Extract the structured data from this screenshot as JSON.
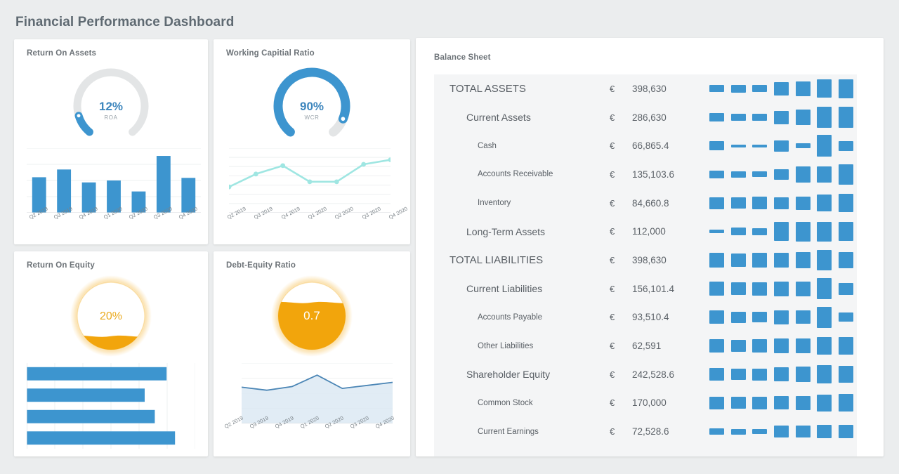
{
  "header": {
    "title": "Financial Performance Dashboard"
  },
  "colors": {
    "page_bg": "#ebedee",
    "card_bg": "#ffffff",
    "blue": "#3d95cf",
    "light_blue": "#9fe6e2",
    "orange": "#f2a50c",
    "text_grey": "#5f6a72"
  },
  "cards": [
    {
      "id": "roa",
      "title": "Return On Assets",
      "gauge": {
        "type": "arc",
        "value_label": "12%",
        "sub_label": "ROA",
        "percent": 12,
        "color": "#3d95cf",
        "track_color": "#e3e5e6"
      },
      "chart": {
        "type": "bar",
        "categories": [
          "Q2 2019",
          "Q3 2019",
          "Q4 2019",
          "Q1 2020",
          "Q2 2020",
          "Q3 2020",
          "Q4 2020"
        ],
        "values": [
          55,
          67,
          47,
          50,
          33,
          88,
          54
        ],
        "ylim": [
          0,
          100
        ],
        "color": "#3d95cf",
        "grid": true
      }
    },
    {
      "id": "wcr",
      "title": "Working Capitial Ratio",
      "gauge": {
        "type": "arc",
        "value_label": "90%",
        "sub_label": "WCR",
        "percent": 90,
        "color": "#3d95cf",
        "track_color": "#e3e5e6"
      },
      "chart": {
        "type": "line",
        "categories": [
          "Q2 2019",
          "Q3 2019",
          "Q4 2019",
          "Q1 2020",
          "Q2 2020",
          "Q3 2020",
          "Q4 2020"
        ],
        "values": [
          40,
          60,
          73,
          48,
          48,
          75,
          82
        ],
        "ylim": [
          0,
          100
        ],
        "color": "#9fe6e2",
        "grid": true
      }
    },
    {
      "id": "roe",
      "title": "Return On Equity",
      "gauge": {
        "type": "liquid-fill",
        "value_label": "20%",
        "sub_label": "",
        "percent": 20,
        "color": "#f2a50c",
        "track_color": "#ffffff"
      },
      "chart": {
        "type": "bar-horizontal",
        "categories": [
          "",
          "",
          "",
          ""
        ],
        "values": [
          83,
          70,
          76,
          88
        ],
        "ylim": [
          0,
          100
        ],
        "color": "#3d95cf",
        "grid": true
      }
    },
    {
      "id": "der",
      "title": "Debt-Equity Ratio",
      "gauge": {
        "type": "liquid-fill",
        "value_label": "0.7",
        "sub_label": "",
        "percent": 70,
        "color": "#f2a50c",
        "track_color": "#ffffff"
      },
      "chart": {
        "type": "area",
        "categories": [
          "Q2 2019",
          "Q3 2019",
          "Q4 2019",
          "Q1 2020",
          "Q2 2020",
          "Q3 2020",
          "Q4 2020"
        ],
        "values": [
          60,
          55,
          61,
          80,
          58,
          63,
          68
        ],
        "ylim": [
          0,
          100
        ],
        "color": "#4a85b5",
        "fill_color": "#dce9f3",
        "grid": true
      }
    }
  ],
  "balance_sheet": {
    "title": "Balance Sheet",
    "currency": "€",
    "rows": [
      {
        "label": "TOTAL ASSETS",
        "level": 0,
        "currency": "€",
        "amount": "398,630",
        "spark": [
          30,
          32,
          30,
          54,
          60,
          76,
          80
        ]
      },
      {
        "label": "Current Assets",
        "level": 1,
        "currency": "€",
        "amount": "286,630",
        "spark": [
          36,
          30,
          32,
          56,
          62,
          86,
          88
        ]
      },
      {
        "label": "Cash",
        "level": 2,
        "currency": "€",
        "amount": "66,865.4",
        "spark": [
          38,
          12,
          12,
          46,
          20,
          92,
          42
        ]
      },
      {
        "label": "Accounts Receivable",
        "level": 2,
        "currency": "€",
        "amount": "135,103.6",
        "spark": [
          30,
          26,
          24,
          46,
          68,
          70,
          86
        ]
      },
      {
        "label": "Inventory",
        "level": 2,
        "currency": "€",
        "amount": "84,660.8",
        "spark": [
          50,
          46,
          52,
          50,
          56,
          72,
          78
        ]
      },
      {
        "label": "Long-Term Assets",
        "level": 1,
        "currency": "€",
        "amount": "112,000",
        "spark": [
          14,
          32,
          30,
          80,
          84,
          82,
          80
        ]
      },
      {
        "label": "TOTAL LIABILITIES",
        "level": 0,
        "currency": "€",
        "amount": "398,630",
        "spark": [
          60,
          58,
          62,
          64,
          68,
          84,
          70
        ]
      },
      {
        "label": "Current Liabilities",
        "level": 1,
        "currency": "€",
        "amount": "156,101.4",
        "spark": [
          58,
          54,
          56,
          62,
          62,
          88,
          50
        ]
      },
      {
        "label": "Accounts Payable",
        "level": 2,
        "currency": "€",
        "amount": "93,510.4",
        "spark": [
          56,
          48,
          44,
          58,
          56,
          90,
          38
        ]
      },
      {
        "label": "Other Liabilities",
        "level": 2,
        "currency": "€",
        "amount": "62,591",
        "spark": [
          56,
          50,
          54,
          62,
          64,
          74,
          72
        ]
      },
      {
        "label": "Shareholder Equity",
        "level": 1,
        "currency": "€",
        "amount": "242,528.6",
        "spark": [
          52,
          48,
          50,
          58,
          66,
          78,
          72
        ]
      },
      {
        "label": "Common Stock",
        "level": 2,
        "currency": "€",
        "amount": "170,000",
        "spark": [
          54,
          50,
          52,
          56,
          60,
          70,
          74
        ]
      },
      {
        "label": "Current Earnings",
        "level": 2,
        "currency": "€",
        "amount": "72,528.6",
        "spark": [
          28,
          24,
          22,
          48,
          52,
          56,
          54
        ]
      }
    ]
  }
}
